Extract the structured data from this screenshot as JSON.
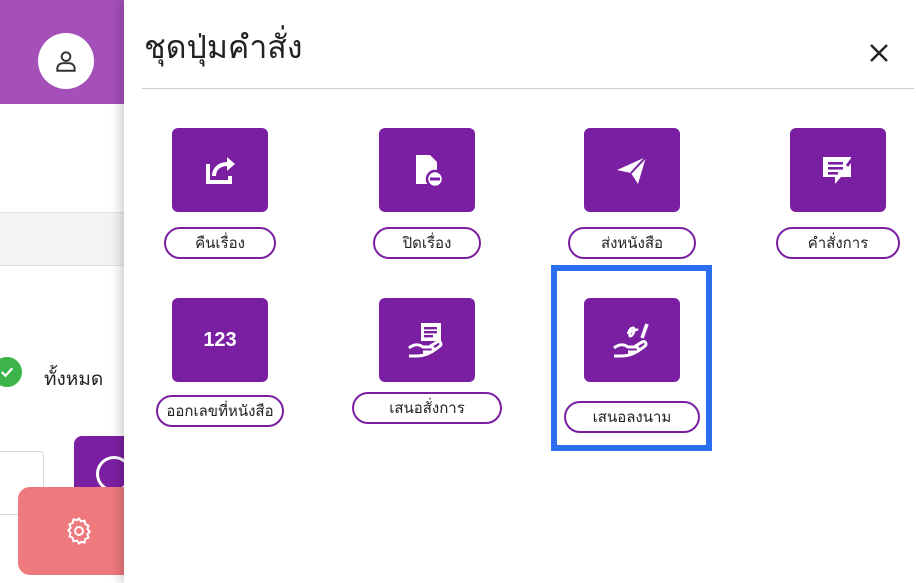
{
  "panel": {
    "title": "ชุดปุ่มคำสั่ง",
    "close_glyph": "✕"
  },
  "commands": [
    {
      "label": "คืนเรื่อง",
      "icon": "share-export-icon"
    },
    {
      "label": "ปิดเรื่อง",
      "icon": "document-close-icon"
    },
    {
      "label": "ส่งหนังสือ",
      "icon": "send-paper-plane-icon"
    },
    {
      "label": "คำสั่งการ",
      "icon": "note-edit-icon"
    },
    {
      "label": "ออกเลขที่หนังสือ",
      "icon": "number-icon",
      "tile_text": "123"
    },
    {
      "label": "เสนอสั่งการ",
      "icon": "hand-document-icon"
    },
    {
      "label": "เสนอลงนาม",
      "icon": "hand-sign-icon",
      "highlighted": true
    }
  ],
  "background": {
    "filter_label": "ทั้งหมด"
  },
  "colors": {
    "header_purple": "#a450b8",
    "tile_purple": "#7b1fa2",
    "highlight_blue": "#2b6ef0",
    "fab_red": "#ef7a7e",
    "check_green": "#3cb44a"
  }
}
